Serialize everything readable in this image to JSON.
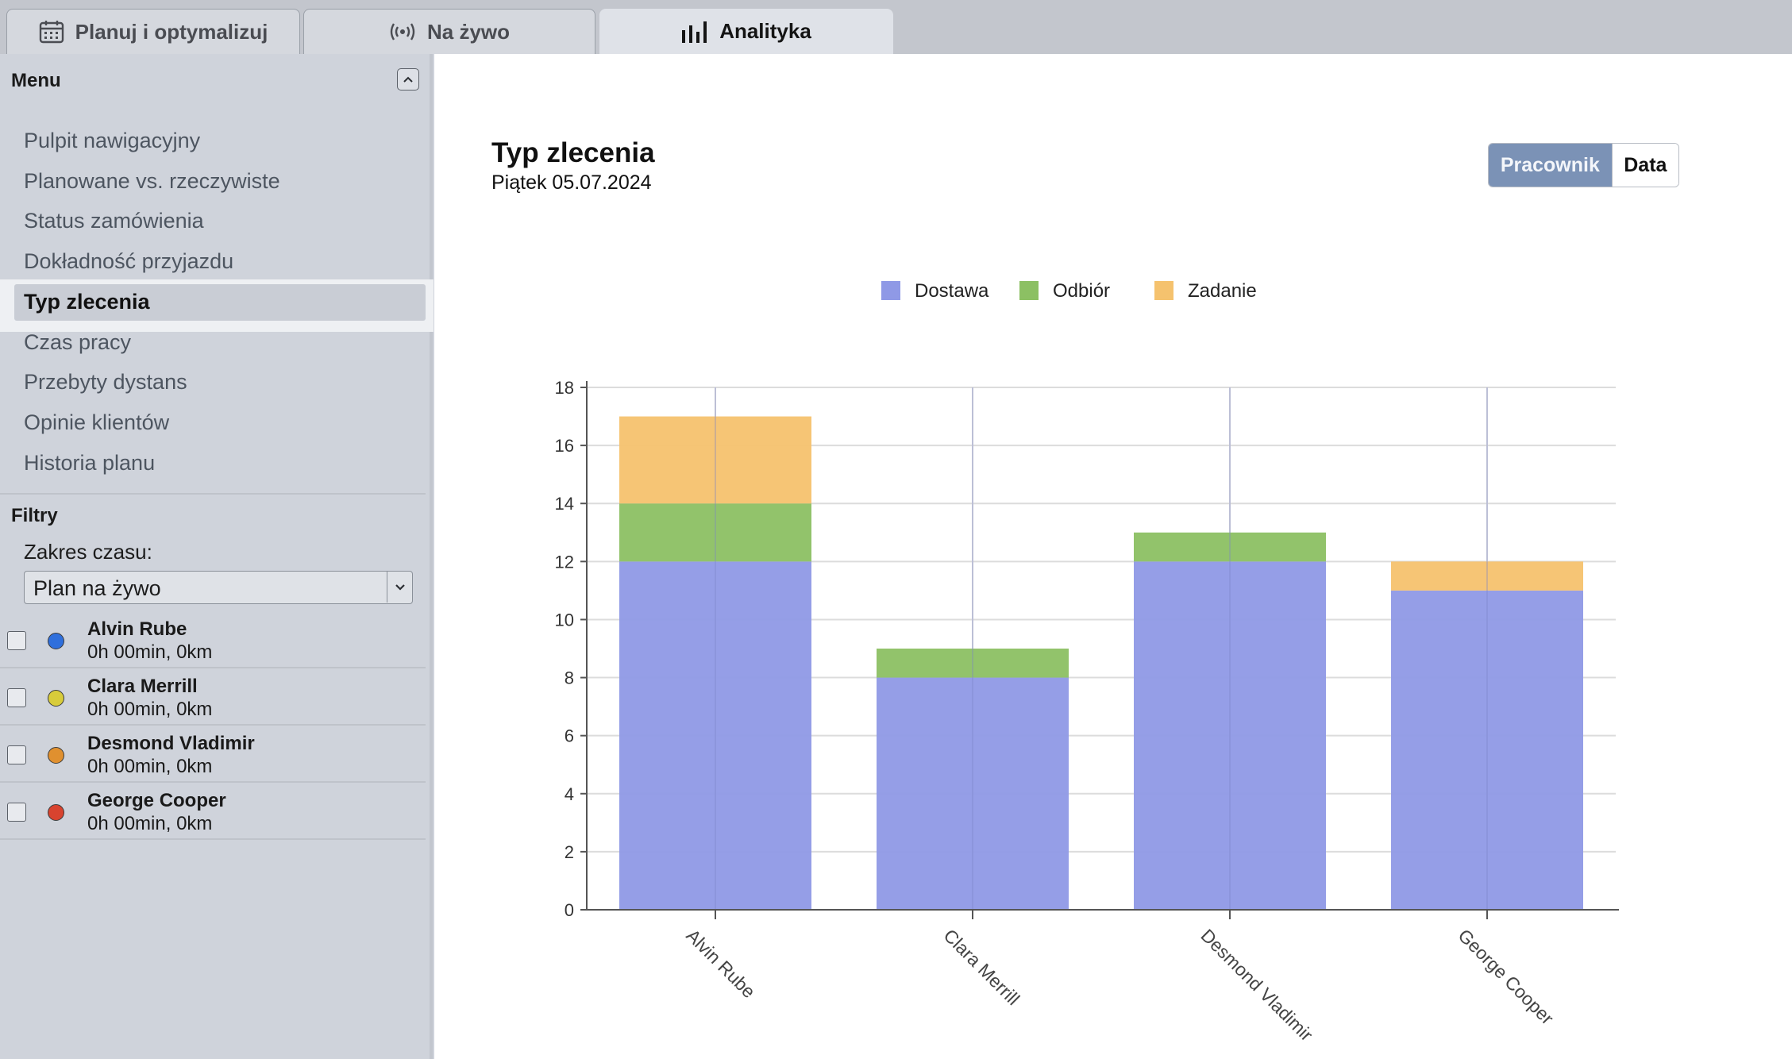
{
  "tabs": [
    {
      "label": "Planuj i optymalizuj",
      "icon": "calendar-icon",
      "active": false
    },
    {
      "label": "Na żywo",
      "icon": "broadcast-icon",
      "active": false
    },
    {
      "label": "Analityka",
      "icon": "bar-chart-icon",
      "active": true
    }
  ],
  "sidebar": {
    "menu_title": "Menu",
    "menu_items": [
      "Pulpit nawigacyjny",
      "Planowane vs. rzeczywiste",
      "Status zamówienia",
      "Dokładność przyjazdu",
      "Typ zlecenia",
      "Czas pracy",
      "Przebyty dystans",
      "Opinie klientów",
      "Historia planu"
    ],
    "active_item": "Typ zlecenia",
    "filters_title": "Filtry",
    "time_range_label": "Zakres czasu:",
    "time_range_value": "Plan na żywo",
    "workers": [
      {
        "name": "Alvin Rube",
        "stats": "0h 00min, 0km",
        "color": "#2f6fdc"
      },
      {
        "name": "Clara Merrill",
        "stats": "0h 00min, 0km",
        "color": "#d8cc3a"
      },
      {
        "name": "Desmond Vladimir",
        "stats": "0h 00min, 0km",
        "color": "#e0902f"
      },
      {
        "name": "George Cooper",
        "stats": "0h 00min, 0km",
        "color": "#d8432f"
      }
    ]
  },
  "main": {
    "title": "Typ zlecenia",
    "date": "Piątek 05.07.2024",
    "toggle": {
      "options": [
        "Pracownik",
        "Data"
      ],
      "selected": "Pracownik"
    }
  },
  "chart_data": {
    "type": "bar",
    "stacked": true,
    "categories": [
      "Alvin Rube",
      "Clara Merrill",
      "Desmond Vladimir",
      "George Cooper"
    ],
    "series": [
      {
        "name": "Dostawa",
        "color": "#8f99e6",
        "values": [
          12,
          8,
          12,
          11
        ]
      },
      {
        "name": "Odbiór",
        "color": "#8cc063",
        "values": [
          2,
          1,
          1,
          0
        ]
      },
      {
        "name": "Zadanie",
        "color": "#f5c26e",
        "values": [
          3,
          0,
          0,
          1
        ]
      }
    ],
    "ylim": [
      0,
      18
    ],
    "yticks": [
      0,
      2,
      4,
      6,
      8,
      10,
      12,
      14,
      16,
      18
    ],
    "grid": true,
    "legend_position": "top-center"
  }
}
